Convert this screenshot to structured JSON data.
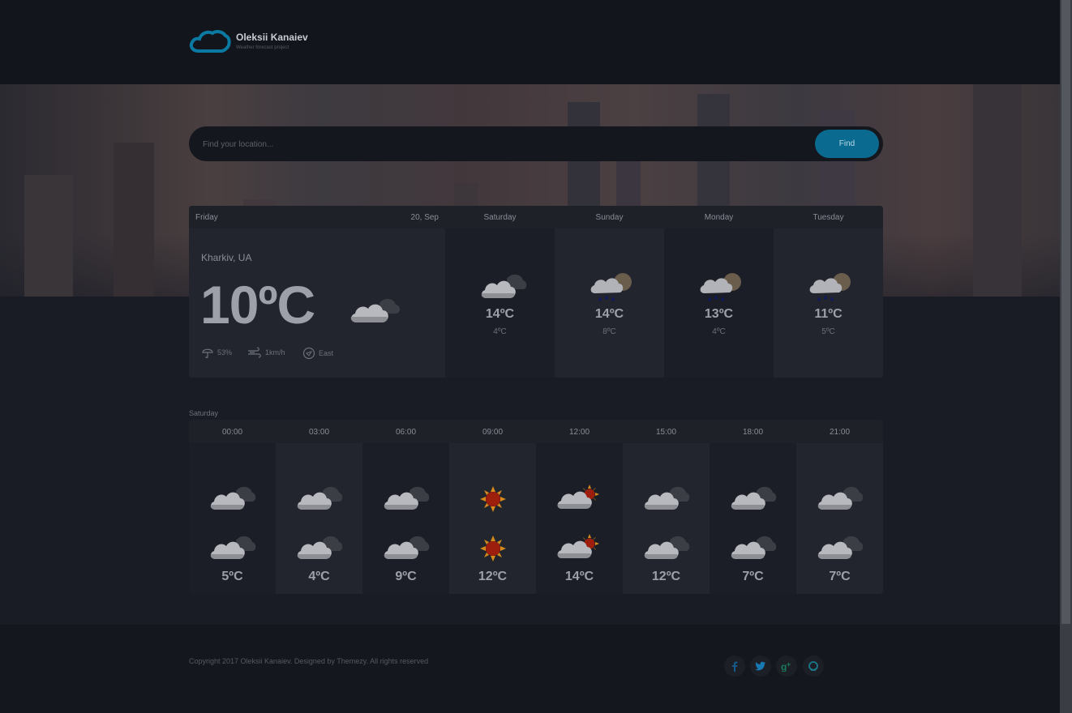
{
  "brand": {
    "name": "Oleksii Kanaiev",
    "tagline": "Weather forecast project",
    "logo_icon": "cloud-icon"
  },
  "search": {
    "placeholder": "Find your location...",
    "value": "",
    "button_label": "Find"
  },
  "today": {
    "day": "Friday",
    "date": "20, Sep",
    "location": "Kharkiv, UA",
    "temperature": "10ºC",
    "icon": "cloud-icon",
    "humidity": "53%",
    "wind_speed": "1km/h",
    "wind_direction": "East"
  },
  "forecast_days": [
    {
      "day": "Saturday",
      "high": "14ºC",
      "low": "4ºC",
      "icon": "cloud-icon"
    },
    {
      "day": "Sunday",
      "high": "14ºC",
      "low": "8ºC",
      "icon": "rain-moon-icon"
    },
    {
      "day": "Monday",
      "high": "13ºC",
      "low": "4ºC",
      "icon": "rain-moon-icon"
    },
    {
      "day": "Tuesday",
      "high": "11ºC",
      "low": "5ºC",
      "icon": "rain-moon-icon"
    }
  ],
  "hourly": {
    "title": "Saturday",
    "slots": [
      {
        "time": "00:00",
        "temp": "5ºC",
        "icon": "cloud-icon"
      },
      {
        "time": "03:00",
        "temp": "4ºC",
        "icon": "cloud-icon"
      },
      {
        "time": "06:00",
        "temp": "9ºC",
        "icon": "cloud-icon"
      },
      {
        "time": "09:00",
        "temp": "12ºC",
        "icon": "sun-icon"
      },
      {
        "time": "12:00",
        "temp": "14ºC",
        "icon": "cloud-sun-icon"
      },
      {
        "time": "15:00",
        "temp": "12ºC",
        "icon": "cloud-icon"
      },
      {
        "time": "18:00",
        "temp": "7ºC",
        "icon": "cloud-icon"
      },
      {
        "time": "21:00",
        "temp": "7ºC",
        "icon": "cloud-icon"
      }
    ]
  },
  "footer": {
    "copyright": "Copyright 2017 Oleksii Kanaiev. Designed by Themezy. All rights reserved",
    "social": [
      "facebook-icon",
      "twitter-icon",
      "google-plus-icon",
      "github-icon"
    ]
  },
  "colors": {
    "accent": "#0a6a90",
    "background": "#1a1c25"
  }
}
